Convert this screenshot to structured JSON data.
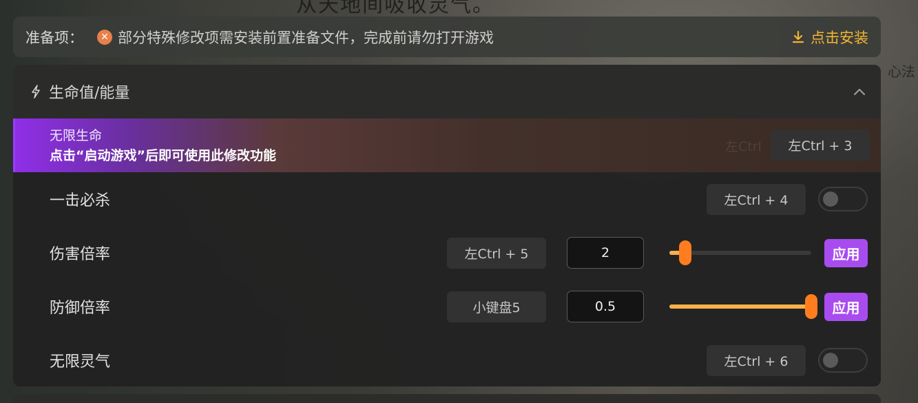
{
  "prep": {
    "label": "准备项：",
    "message": "部分特殊修改项需安装前置准备文件，完成前请勿打开游戏",
    "install_label": "点击安装"
  },
  "background": {
    "top_text": "从天地间吸收灵气。",
    "right_text": "心法"
  },
  "section": {
    "title": "生命值/能量",
    "icon": "bolt-icon"
  },
  "rows": [
    {
      "name": "无限生命",
      "subtitle": "点击“启动游戏”后即可使用此修改功能",
      "hotkey": "左Ctrl + 3",
      "ghost_hotkey": "左Ctrl"
    },
    {
      "name": "一击必杀",
      "hotkey": "左Ctrl + 4",
      "toggle": false
    },
    {
      "name": "伤害倍率",
      "hotkey": "左Ctrl + 5",
      "value": "2",
      "slider_fraction": 0.11,
      "apply_label": "应用"
    },
    {
      "name": "防御倍率",
      "hotkey": "小键盘5",
      "value": "0.5",
      "slider_fraction": 1.0,
      "apply_label": "应用"
    },
    {
      "name": "无限灵气",
      "hotkey": "左Ctrl + 6",
      "toggle": false
    }
  ],
  "colors": {
    "accent_purple": "#a84cf0",
    "slider_orange": "#ff7d1f",
    "install_gold": "#f2b533",
    "warning_orange": "#e8804a"
  }
}
